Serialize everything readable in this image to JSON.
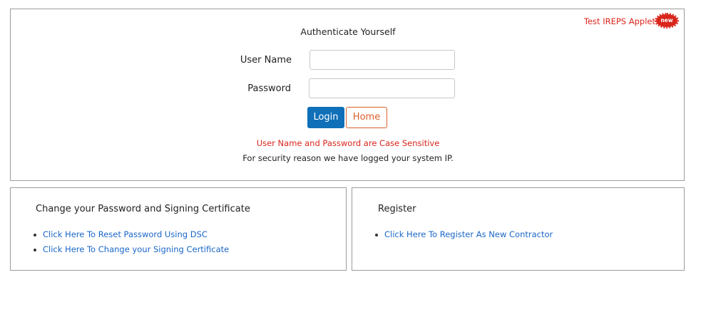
{
  "auth": {
    "title": "Authenticate Yourself",
    "applet_link": "Test IREPS Applet",
    "new_badge": "new",
    "username_label": "User Name",
    "username_value": "",
    "password_label": "Password",
    "password_value": "",
    "login_label": "Login",
    "home_label": "Home",
    "case_note": "User Name and Password are Case Sensitive",
    "ip_note": "For security reason we have logged your system IP."
  },
  "password_section": {
    "title": "Change your Password and Signing Certificate",
    "links": [
      "Click Here To Reset Password Using DSC",
      "Click Here To Change your Signing Certificate"
    ]
  },
  "register_section": {
    "title": "Register",
    "links": [
      "Click Here To Register As New Contractor"
    ]
  },
  "colors": {
    "accent_blue": "#0f6fb8",
    "link_blue": "#1a66c8",
    "alert_red": "#d9251c",
    "home_orange": "#d9612c",
    "border_gray": "#9c9c9c"
  }
}
